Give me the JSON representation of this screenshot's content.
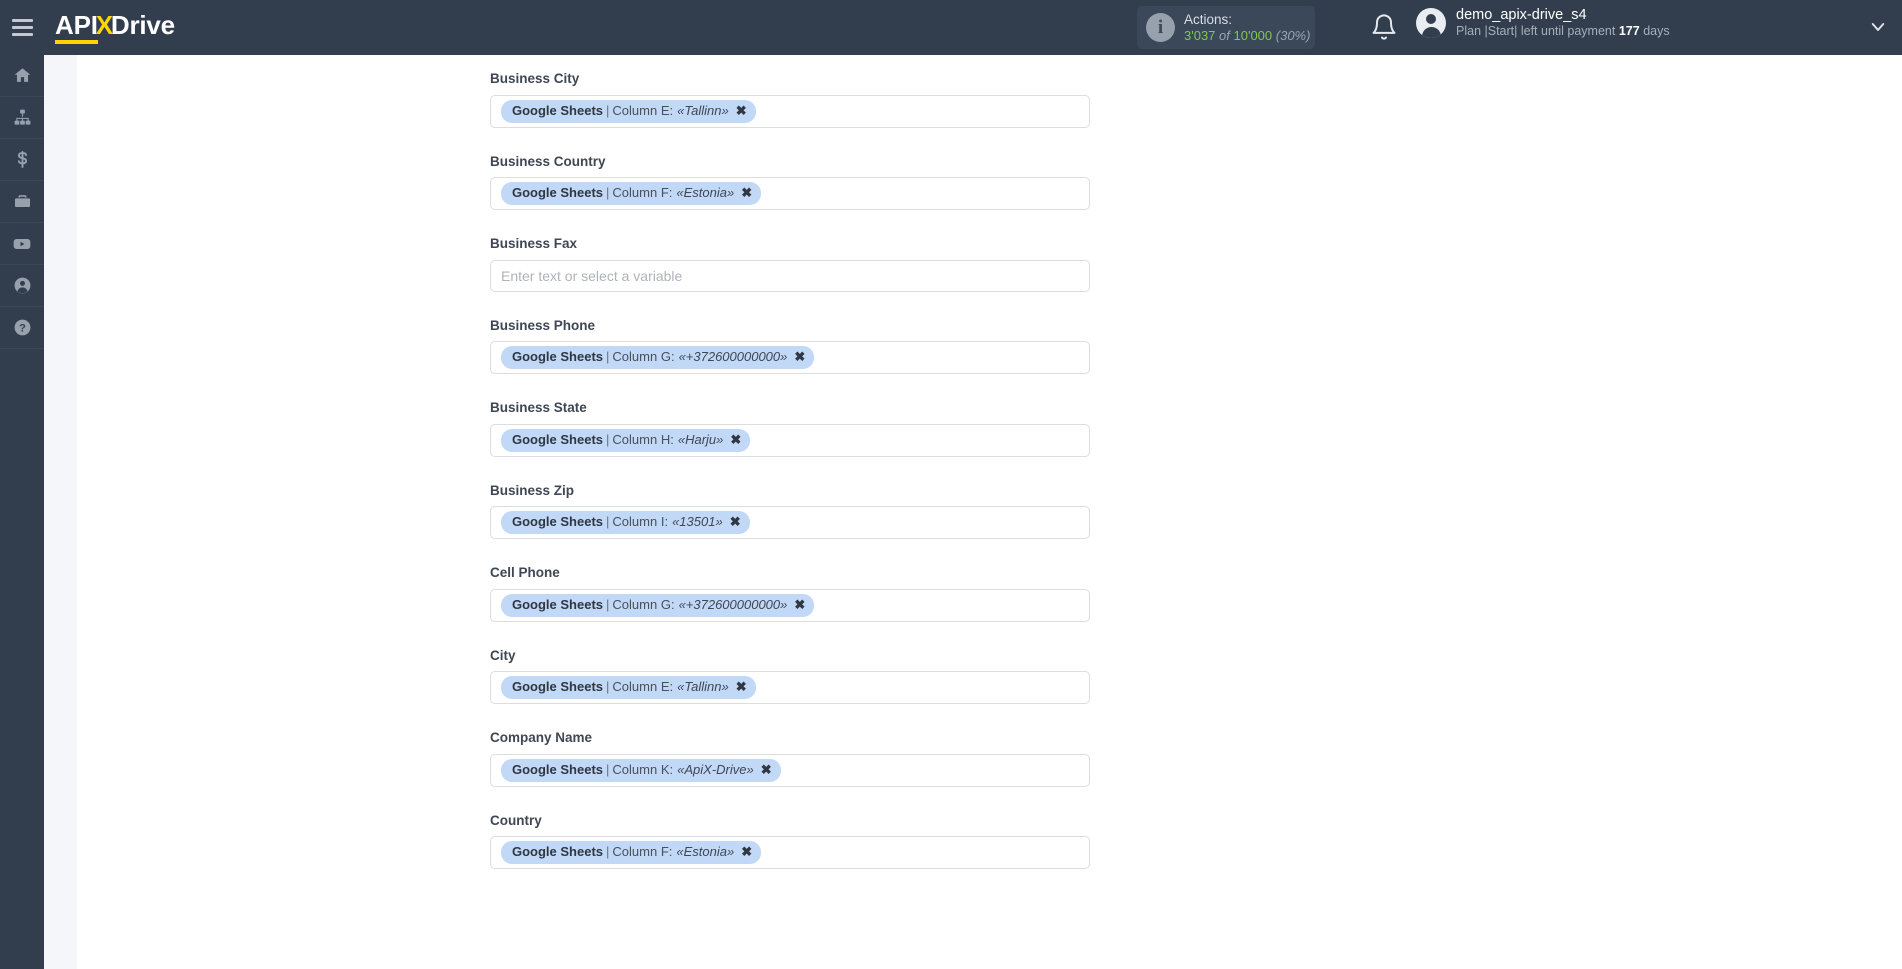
{
  "header": {
    "menu_icon": "hamburger-icon",
    "brand": {
      "part1": "API",
      "part2": "X",
      "part3": "Drive"
    },
    "actions": {
      "info_icon": "info-icon",
      "title": "Actions:",
      "used": "3'037",
      "of": "of",
      "total": "10'000",
      "percent": "(30%)"
    },
    "bell_icon": "bell-icon",
    "user": {
      "avatar_icon": "avatar-icon",
      "name": "demo_apix-drive_s4",
      "plan_prefix": "Plan |Start| left until payment",
      "plan_days": "177",
      "plan_suffix": "days",
      "chevron_icon": "chevron-down-icon"
    }
  },
  "sidebar": {
    "items": [
      {
        "icon": "home-icon",
        "name": "sidebar-item-home"
      },
      {
        "icon": "connections-icon",
        "name": "sidebar-item-connections"
      },
      {
        "icon": "dollar-icon",
        "name": "sidebar-item-billing"
      },
      {
        "icon": "briefcase-icon",
        "name": "sidebar-item-business"
      },
      {
        "icon": "youtube-icon",
        "name": "sidebar-item-video"
      },
      {
        "icon": "account-icon",
        "name": "sidebar-item-account"
      },
      {
        "icon": "help-icon",
        "name": "sidebar-item-help"
      }
    ]
  },
  "form": {
    "placeholder": "Enter text or select a variable",
    "fields": [
      {
        "label": "Business City",
        "has_chip": true,
        "chip": {
          "source": "Google Sheets",
          "separator": "|",
          "column": "Column E:",
          "value": "«Tallinn»",
          "remove": "✖"
        }
      },
      {
        "label": "Business Country",
        "has_chip": true,
        "chip": {
          "source": "Google Sheets",
          "separator": "|",
          "column": "Column F:",
          "value": "«Estonia»",
          "remove": "✖"
        }
      },
      {
        "label": "Business Fax",
        "has_chip": false,
        "chip": null
      },
      {
        "label": "Business Phone",
        "has_chip": true,
        "chip": {
          "source": "Google Sheets",
          "separator": "|",
          "column": "Column G:",
          "value": "«+372600000000»",
          "remove": "✖"
        }
      },
      {
        "label": "Business State",
        "has_chip": true,
        "chip": {
          "source": "Google Sheets",
          "separator": "|",
          "column": "Column H:",
          "value": "«Harju»",
          "remove": "✖"
        }
      },
      {
        "label": "Business Zip",
        "has_chip": true,
        "chip": {
          "source": "Google Sheets",
          "separator": "|",
          "column": "Column I:",
          "value": "«13501»",
          "remove": "✖"
        }
      },
      {
        "label": "Cell Phone",
        "has_chip": true,
        "chip": {
          "source": "Google Sheets",
          "separator": "|",
          "column": "Column G:",
          "value": "«+372600000000»",
          "remove": "✖"
        }
      },
      {
        "label": "City",
        "has_chip": true,
        "chip": {
          "source": "Google Sheets",
          "separator": "|",
          "column": "Column E:",
          "value": "«Tallinn»",
          "remove": "✖"
        }
      },
      {
        "label": "Company Name",
        "has_chip": true,
        "chip": {
          "source": "Google Sheets",
          "separator": "|",
          "column": "Column K:",
          "value": "«ApiX-Drive»",
          "remove": "✖"
        }
      },
      {
        "label": "Country",
        "has_chip": true,
        "chip": {
          "source": "Google Sheets",
          "separator": "|",
          "column": "Column F:",
          "value": "«Estonia»",
          "remove": "✖"
        }
      }
    ]
  },
  "colors": {
    "topbar": "#323e4d",
    "brand_accent": "#ffd400",
    "chip_bg": "#c2d8f7",
    "counter_green": "#7ec756",
    "strip_bg": "#f4f6f9"
  }
}
